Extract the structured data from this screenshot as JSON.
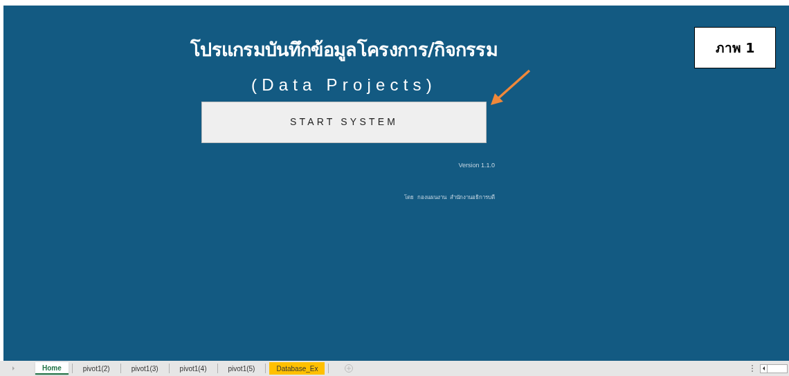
{
  "title": "โปรแกรมบันทึกข้อมูลโครงการ/กิจกรรม",
  "subtitle": "(Data Projects)",
  "start_button": "START SYSTEM",
  "version": "Version 1.1.0",
  "credit": "โดย  กองแผนงาน  สำนักงานอธิการบดี",
  "figure_label": "ภาพ 1",
  "sheet_tabs": [
    {
      "label": "Home",
      "selected": true
    },
    {
      "label": "pivot1(2)",
      "selected": false
    },
    {
      "label": "pivot1(3)",
      "selected": false
    },
    {
      "label": "pivot1(4)",
      "selected": false
    },
    {
      "label": "pivot1(5)",
      "selected": false
    },
    {
      "label": "Database_Ex",
      "selected": false,
      "color": "#ffc000"
    }
  ]
}
